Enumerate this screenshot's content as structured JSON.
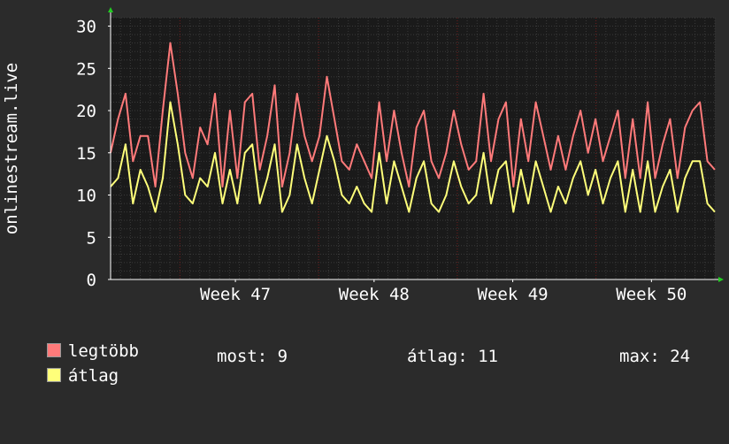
{
  "colors": {
    "background": "#2b2b2b",
    "plot_background": "#1a1a1a",
    "grid": "#3a3a3a",
    "series_max": "#ff7a7a",
    "series_avg": "#ffff7a",
    "axis_arrow": "#22cc22",
    "week_marker": "#6b1a1a"
  },
  "legend": {
    "max_label": "legtöbb",
    "avg_label": "átlag",
    "now_stat": "most: 9",
    "avg_stat": "átlag: 11",
    "max_stat": "max: 24"
  },
  "chart_data": {
    "type": "line",
    "ylabel": "onlinestream.live",
    "ylim": [
      0,
      31
    ],
    "yticks": [
      "0",
      "5",
      "10",
      "15",
      "20",
      "25",
      "30"
    ],
    "xlabel": "",
    "xlim": [
      0,
      30.5
    ],
    "xticks": [
      {
        "label": "Week 47",
        "x": 6.3
      },
      {
        "label": "Week 48",
        "x": 13.3
      },
      {
        "label": "Week 49",
        "x": 20.3
      },
      {
        "label": "Week 50",
        "x": 27.3
      }
    ],
    "week_boundaries": [
      3.5,
      10.5,
      17.5,
      24.5
    ],
    "grid": true,
    "x_unit": "days",
    "series": [
      {
        "name": "legtöbb",
        "color": "#ff7a7a",
        "values": [
          15,
          19,
          22,
          14,
          17,
          17,
          11,
          20,
          28,
          22,
          15,
          12,
          18,
          16,
          22,
          11,
          20,
          12,
          21,
          22,
          13,
          17,
          23,
          11,
          15,
          22,
          17,
          14,
          17,
          24,
          19,
          14,
          13,
          16,
          14,
          12,
          21,
          14,
          20,
          15,
          11,
          18,
          20,
          14,
          12,
          15,
          20,
          16,
          13,
          14,
          22,
          14,
          19,
          21,
          11,
          19,
          14,
          21,
          17,
          13,
          17,
          13,
          17,
          20,
          15,
          19,
          14,
          17,
          20,
          12,
          19,
          12,
          21,
          12,
          16,
          19,
          12,
          18,
          20,
          21,
          14,
          13
        ]
      },
      {
        "name": "átlag",
        "color": "#ffff7a",
        "values": [
          11,
          12,
          16,
          9,
          13,
          11,
          8,
          12,
          21,
          16,
          10,
          9,
          12,
          11,
          15,
          9,
          13,
          9,
          15,
          16,
          9,
          12,
          16,
          8,
          10,
          16,
          12,
          9,
          13,
          17,
          14,
          10,
          9,
          11,
          9,
          8,
          15,
          9,
          14,
          11,
          8,
          12,
          14,
          9,
          8,
          10,
          14,
          11,
          9,
          10,
          15,
          9,
          13,
          14,
          8,
          13,
          9,
          14,
          11,
          8,
          11,
          9,
          12,
          14,
          10,
          13,
          9,
          12,
          14,
          8,
          13,
          8,
          14,
          8,
          11,
          13,
          8,
          12,
          14,
          14,
          9,
          8
        ]
      }
    ]
  }
}
